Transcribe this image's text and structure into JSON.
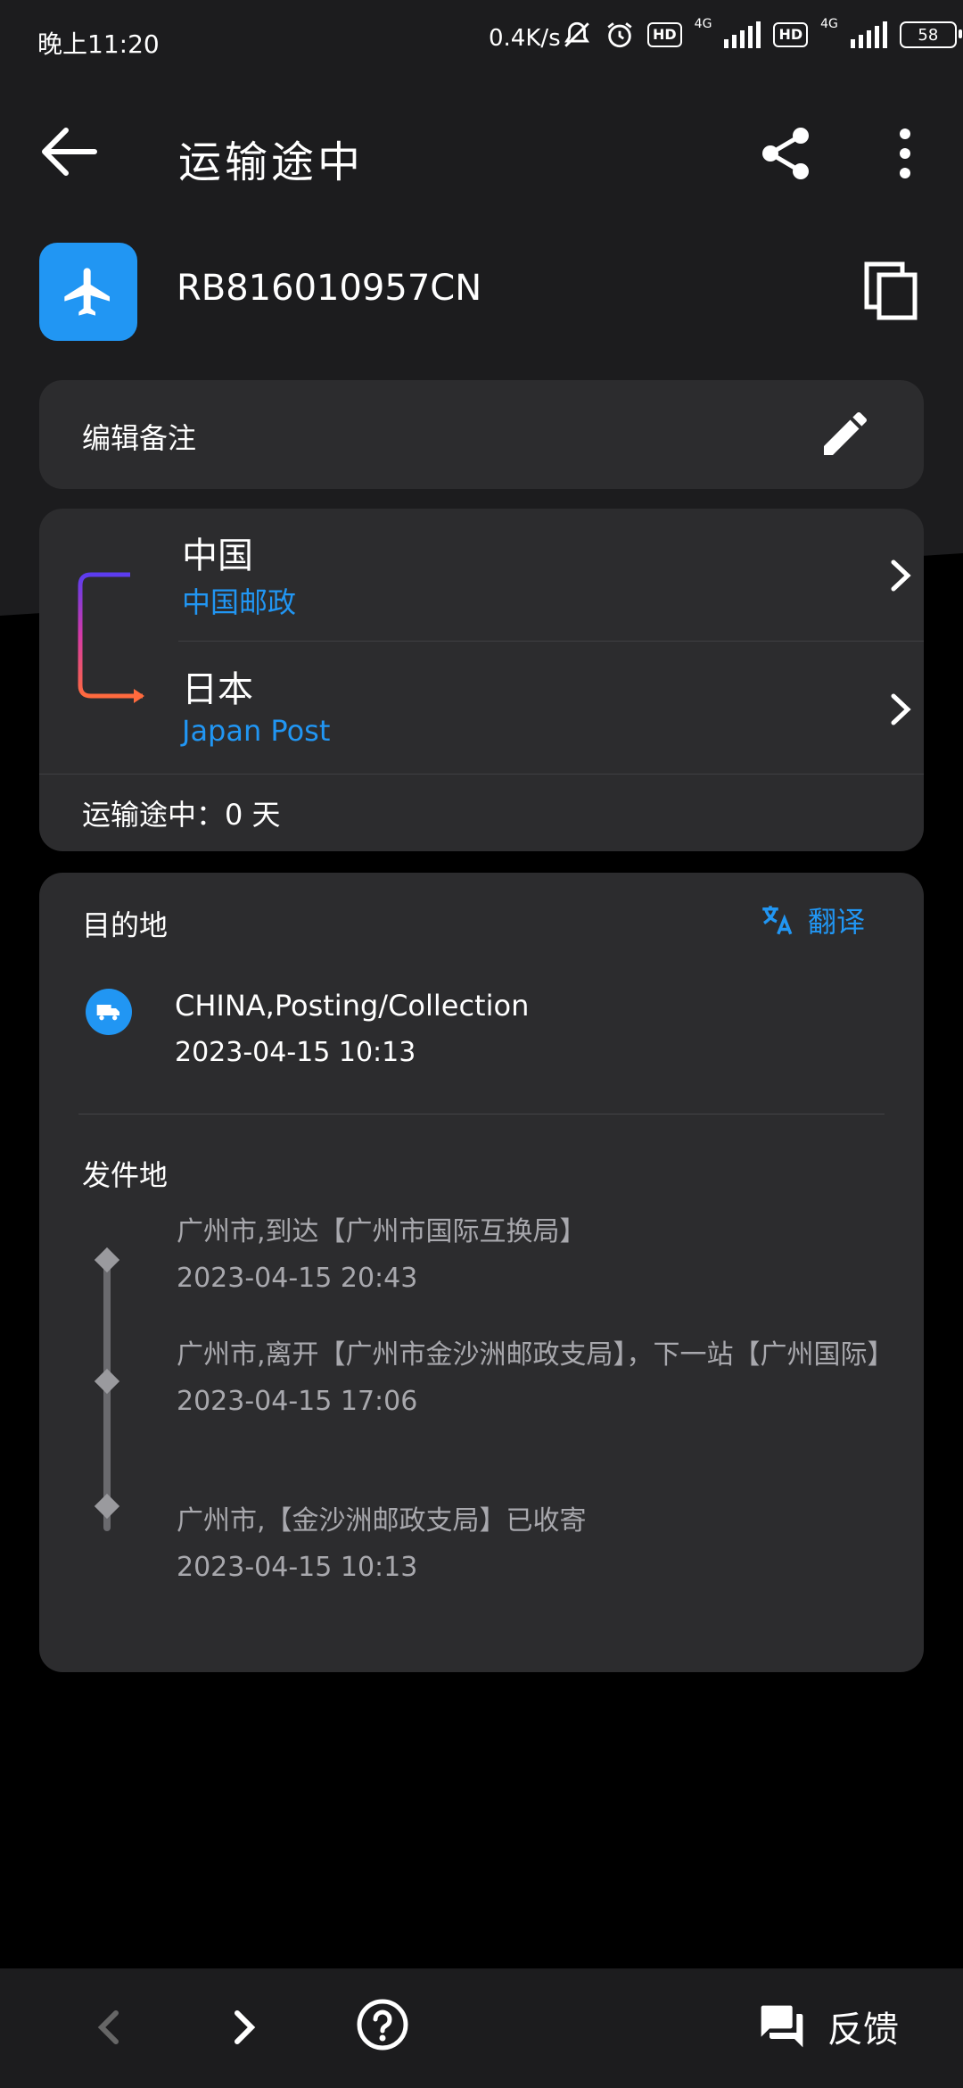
{
  "status_bar": {
    "time": "晚上11:20",
    "speed": "0.4K/s",
    "hd_label": "HD",
    "network_label": "4G",
    "battery": "58"
  },
  "header": {
    "title": "运输途中"
  },
  "tracking": {
    "number": "RB816010957CN"
  },
  "note": {
    "label": "编辑备注"
  },
  "route": {
    "origin_country": "中国",
    "origin_carrier": "中国邮政",
    "dest_country": "日本",
    "dest_carrier": "Japan Post",
    "transit": "运输途中：0 天"
  },
  "destination": {
    "label": "目的地",
    "translate_label": "翻译",
    "event_text": "CHINA,Posting/Collection",
    "event_time": "2023-04-15 10:13"
  },
  "origin": {
    "label": "发件地",
    "events": [
      {
        "text": "广州市,到达【广州市国际互换局】",
        "time": "2023-04-15 20:43"
      },
      {
        "text": "广州市,离开【广州市金沙洲邮政支局】，下一站【广州国际】",
        "time": "2023-04-15 17:06"
      },
      {
        "text": "广州市,【金沙洲邮政支局】已收寄",
        "time": "2023-04-15 10:13"
      }
    ]
  },
  "bottom_nav": {
    "feedback_label": "反馈"
  },
  "colors": {
    "accent": "#2196f3",
    "card": "#2c2c2e",
    "background": "#1c1c1e"
  }
}
